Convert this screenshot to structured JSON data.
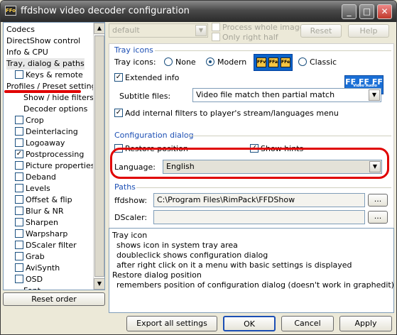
{
  "window": {
    "title": "ffdshow video decoder configuration",
    "icon_text": "FFo",
    "controls": [
      "_",
      "□",
      "✕"
    ]
  },
  "tree": {
    "items": [
      {
        "label": "Codecs",
        "indent": 0,
        "check": null
      },
      {
        "label": "DirectShow control",
        "indent": 0,
        "check": null
      },
      {
        "label": "Info & CPU",
        "indent": 0,
        "check": null
      },
      {
        "label": "Tray, dialog & paths",
        "indent": 0,
        "check": null,
        "selected": true
      },
      {
        "label": "Keys & remote",
        "indent": 1,
        "check": false
      },
      {
        "label": "Profiles / Preset settings",
        "indent": 0,
        "check": null
      },
      {
        "label": "Show / hide filters",
        "indent": 2,
        "check": null
      },
      {
        "label": "Decoder options",
        "indent": 2,
        "check": null
      },
      {
        "label": "Crop",
        "indent": 1,
        "check": false
      },
      {
        "label": "Deinterlacing",
        "indent": 1,
        "check": false
      },
      {
        "label": "Logoaway",
        "indent": 1,
        "check": false
      },
      {
        "label": "Postprocessing",
        "indent": 1,
        "check": true
      },
      {
        "label": "Picture properties",
        "indent": 1,
        "check": false
      },
      {
        "label": "Deband",
        "indent": 1,
        "check": false
      },
      {
        "label": "Levels",
        "indent": 1,
        "check": false
      },
      {
        "label": "Offset & flip",
        "indent": 1,
        "check": false
      },
      {
        "label": "Blur & NR",
        "indent": 1,
        "check": false
      },
      {
        "label": "Sharpen",
        "indent": 1,
        "check": false
      },
      {
        "label": "Warpsharp",
        "indent": 1,
        "check": false
      },
      {
        "label": "DScaler filter",
        "indent": 1,
        "check": false
      },
      {
        "label": "Grab",
        "indent": 1,
        "check": false
      },
      {
        "label": "AviSynth",
        "indent": 1,
        "check": false
      },
      {
        "label": "OSD",
        "indent": 1,
        "check": false
      },
      {
        "label": "Font",
        "indent": 2,
        "check": null
      }
    ],
    "reset_order_label": "Reset order"
  },
  "top": {
    "preset_value": "default",
    "process_whole_image": "Process whole image",
    "only_right_half": "Only right half",
    "reset_label": "Reset",
    "help_label": "Help"
  },
  "tray": {
    "group_title": "Tray icons",
    "tray_icons_label": "Tray icons:",
    "radio_none": "None",
    "radio_modern": "Modern",
    "radio_classic": "Classic",
    "modern_tiles": [
      "FFv",
      "FFa",
      "FFe"
    ],
    "classic_tiles_text": "FF FF FF",
    "classic_sub": "Video Audio Encoder",
    "extended_info": "Extended info",
    "subtitle_files_label": "Subtitle files:",
    "subtitle_files_value": "Video file match then partial match",
    "add_internal_filters": "Add internal filters to player's stream/languages menu"
  },
  "config": {
    "group_title": "Configuration dialog",
    "restore_position": "Restore position",
    "show_hints": "Show hints",
    "language_label": "Language:",
    "language_value": "English"
  },
  "paths": {
    "group_title": "Paths",
    "ffdshow_label": "ffdshow:",
    "ffdshow_value": "C:\\Program Files\\RimPack\\FFDShow",
    "dscaler_label": "DScaler:",
    "dscaler_value": "",
    "browse_label": "..."
  },
  "info": {
    "lines": [
      "Tray icon",
      "  shows icon in system tray area",
      "  doubleclick shows configuration dialog",
      "  after right click on it a menu with basic settings is displayed",
      "Restore dialog position",
      "  remembers position of configuration dialog (doesn't work in graphedit)"
    ]
  },
  "bottom": {
    "export_label": "Export all settings",
    "ok_label": "OK",
    "cancel_label": "Cancel",
    "apply_label": "Apply"
  },
  "colors": {
    "highlight_red": "#e00000",
    "group_title_blue": "#1c4fb4",
    "logo_blue": "#0a63c8"
  }
}
